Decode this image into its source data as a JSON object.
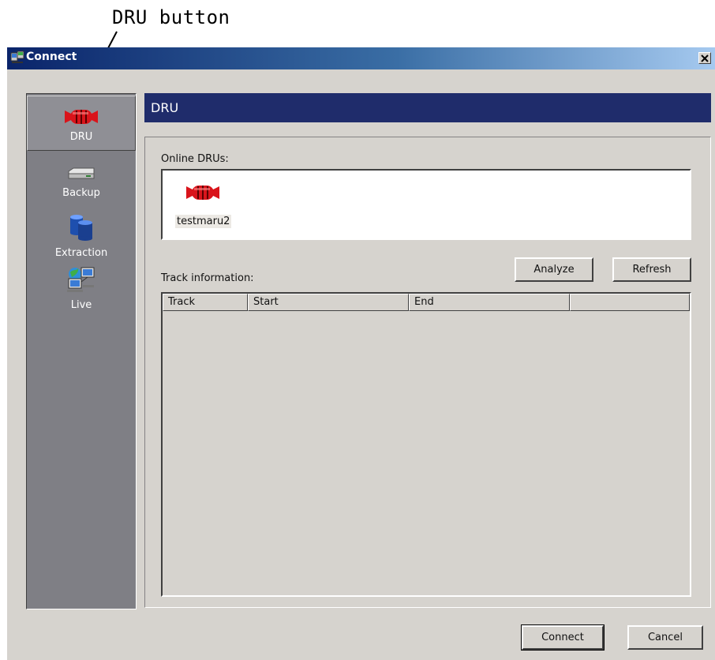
{
  "annotation": {
    "label": "DRU button"
  },
  "window": {
    "title": "Connect",
    "close_glyph": "✕"
  },
  "sidebar": {
    "items": [
      {
        "label": "DRU",
        "icon": "dru-icon",
        "selected": true
      },
      {
        "label": "Backup",
        "icon": "backup-drive-icon",
        "selected": false
      },
      {
        "label": "Extraction",
        "icon": "database-icon",
        "selected": false
      },
      {
        "label": "Live",
        "icon": "live-network-icon",
        "selected": false
      }
    ]
  },
  "header": {
    "title": "DRU"
  },
  "online": {
    "label": "Online DRUs:",
    "items": [
      {
        "name": "testmaru2",
        "icon": "dru-icon"
      }
    ]
  },
  "buttons": {
    "analyze": "Analyze",
    "refresh": "Refresh",
    "connect": "Connect",
    "cancel": "Cancel"
  },
  "track": {
    "label": "Track information:",
    "columns": [
      "Track",
      "Start",
      "End",
      ""
    ],
    "rows": []
  },
  "colors": {
    "header_bar": "#1f2c6b",
    "sidebar": "#7f7f85",
    "dialog_bg": "#d6d3ce",
    "dru_red": "#d9141b"
  }
}
